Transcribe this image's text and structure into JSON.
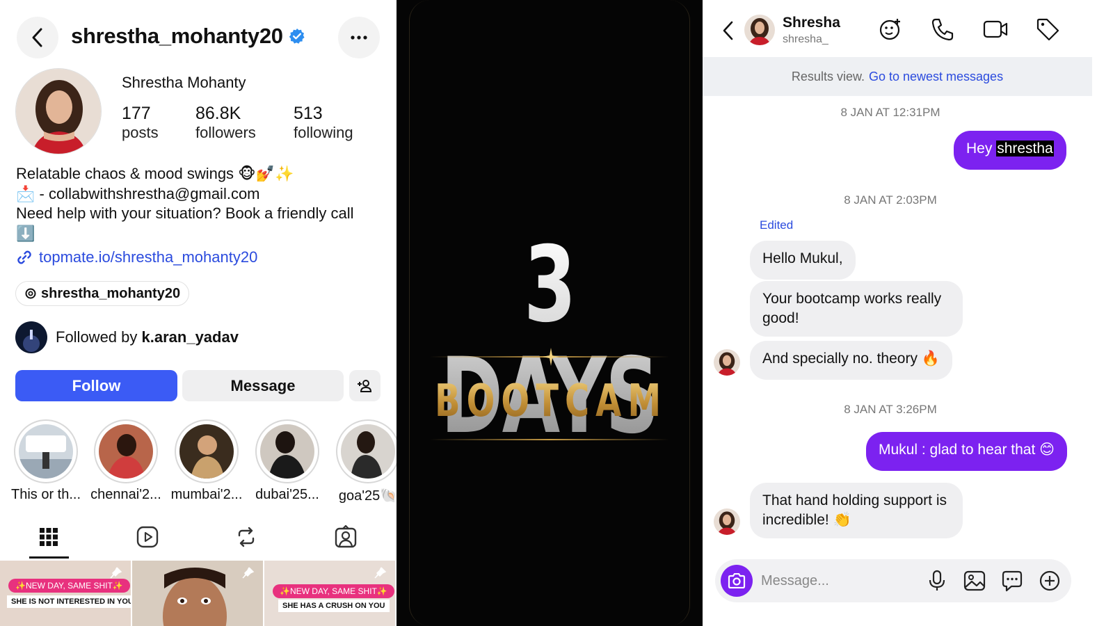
{
  "profile": {
    "username": "shrestha_mohanty20",
    "full_name": "Shrestha Mohanty",
    "posts_count": "177",
    "posts_label": "posts",
    "followers_count": "86.8K",
    "followers_label": "followers",
    "following_count": "513",
    "following_label": "following",
    "bio_line1": "Relatable chaos & mood swings 🐵💅✨",
    "bio_line2": "📩 - collabwithshrestha@gmail.com",
    "bio_line3": "Need help with your situation? Book a friendly call",
    "bio_line4": "⬇️",
    "link": "topmate.io/shrestha_mohanty20",
    "threads_handle": "shrestha_mohanty20",
    "followed_by_prefix": "Followed by ",
    "followed_by_user": "k.aran_yadav",
    "follow_label": "Follow",
    "message_label": "Message",
    "highlights": [
      {
        "label": "This or th..."
      },
      {
        "label": "chennai'2..."
      },
      {
        "label": "mumbai'2..."
      },
      {
        "label": "dubai'25..."
      },
      {
        "label": "goa'25🐚"
      }
    ],
    "thumbs": [
      {
        "pill": "✨NEW DAY, SAME SHIT✨",
        "sub": "SHE IS NOT INTERESTED IN YOU"
      },
      {
        "pill": "",
        "sub": ""
      },
      {
        "pill": "✨NEW DAY, SAME SHIT✨",
        "sub": "SHE HAS A CRUSH ON YOU"
      }
    ]
  },
  "promo": {
    "title": "3 DAYS",
    "subtitle": "BOOTCAMP"
  },
  "dm": {
    "name": "Shresha",
    "handle": "shresha_",
    "results_text": "Results view.",
    "results_link": "Go to newest messages",
    "ts1": "8 JAN AT 12:31PM",
    "msg1_a": "Hey ",
    "msg1_b": "shrestha",
    "ts2": "8 JAN AT 2:03PM",
    "edited": "Edited",
    "msg2": "Hello Mukul,",
    "msg3": "Your bootcamp works really good!",
    "msg4": "And specially no. theory 🔥",
    "ts3": "8 JAN AT 3:26PM",
    "msg5": "Mukul : glad to hear that 😊",
    "msg6": "That hand holding support is incredible! 👏",
    "composer_placeholder": "Message..."
  },
  "colors": {
    "follow_blue": "#3b5bf5",
    "link_blue": "#2b4bde",
    "dm_purple": "#7c22f0",
    "gold": "#c59a45"
  }
}
